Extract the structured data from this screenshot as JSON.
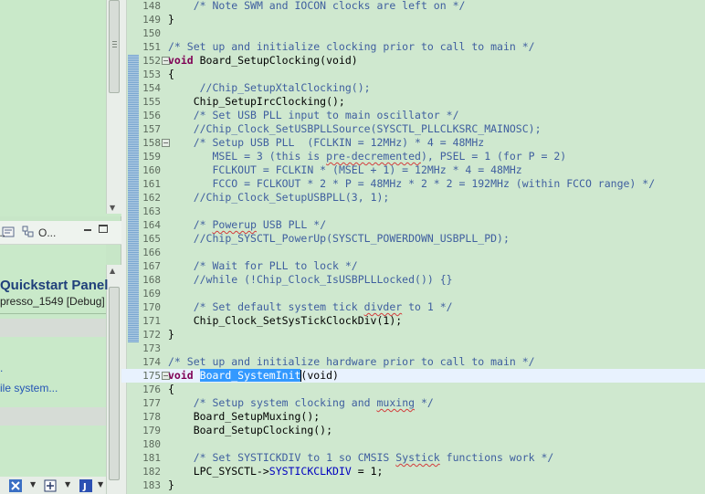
{
  "left_panel": {
    "views": [
      {
        "icon": "views-icon",
        "label": "..."
      },
      {
        "icon": "outline-icon",
        "label": "O..."
      }
    ],
    "quickstart": {
      "title": "Quickstart Panel",
      "subtitle": "presso_1549 [Debug]",
      "link_dot": ".",
      "link_text": "ile system..."
    }
  },
  "editor": {
    "lines": [
      {
        "num": "148",
        "fold": "",
        "text": "    /* Note SWM and IOCON clocks are left on */",
        "kind": "comment"
      },
      {
        "num": "149",
        "fold": "",
        "text": "}",
        "kind": "plain"
      },
      {
        "num": "150",
        "fold": "",
        "text": "",
        "kind": "plain"
      },
      {
        "num": "151",
        "fold": "",
        "text": "/* Set up and initialize clocking prior to call to main */",
        "kind": "comment"
      },
      {
        "num": "152",
        "fold": "minus",
        "text": "void Board_SetupClocking(void)",
        "kind": "decl"
      },
      {
        "num": "153",
        "fold": "",
        "text": "{",
        "kind": "plain"
      },
      {
        "num": "154",
        "fold": "",
        "text": "     //Chip_SetupXtalClocking();",
        "kind": "comment"
      },
      {
        "num": "155",
        "fold": "",
        "text": "    Chip_SetupIrcClocking();",
        "kind": "plain"
      },
      {
        "num": "156",
        "fold": "",
        "text": "    /* Set USB PLL input to main oscillator */",
        "kind": "comment"
      },
      {
        "num": "157",
        "fold": "",
        "text": "    //Chip_Clock_SetUSBPLLSource(SYSCTL_PLLCLKSRC_MAINOSC);",
        "kind": "comment"
      },
      {
        "num": "158",
        "fold": "minus",
        "text": "    /* Setup USB PLL  (FCLKIN = 12MHz) * 4 = 48MHz",
        "kind": "comment"
      },
      {
        "num": "159",
        "fold": "",
        "text": "       MSEL = 3 (this is pre-decremented), PSEL = 1 (for P = 2)",
        "kind": "comment"
      },
      {
        "num": "160",
        "fold": "",
        "text": "       FCLKOUT = FCLKIN * (MSEL + 1) = 12MHz * 4 = 48MHz",
        "kind": "comment"
      },
      {
        "num": "161",
        "fold": "",
        "text": "       FCCO = FCLKOUT * 2 * P = 48MHz * 2 * 2 = 192MHz (within FCCO range) */",
        "kind": "comment"
      },
      {
        "num": "162",
        "fold": "",
        "text": "    //Chip_Clock_SetupUSBPLL(3, 1);",
        "kind": "comment"
      },
      {
        "num": "163",
        "fold": "",
        "text": "",
        "kind": "plain"
      },
      {
        "num": "164",
        "fold": "",
        "text": "    /* Powerup USB PLL */",
        "kind": "comment"
      },
      {
        "num": "165",
        "fold": "",
        "text": "    //Chip_SYSCTL_PowerUp(SYSCTL_POWERDOWN_USBPLL_PD);",
        "kind": "comment"
      },
      {
        "num": "166",
        "fold": "",
        "text": "",
        "kind": "plain"
      },
      {
        "num": "167",
        "fold": "",
        "text": "    /* Wait for PLL to lock */",
        "kind": "comment"
      },
      {
        "num": "168",
        "fold": "",
        "text": "    //while (!Chip_Clock_IsUSBPLLLocked()) {}",
        "kind": "comment"
      },
      {
        "num": "169",
        "fold": "",
        "text": "",
        "kind": "plain"
      },
      {
        "num": "170",
        "fold": "",
        "text": "    /* Set default system tick divder to 1 */",
        "kind": "comment"
      },
      {
        "num": "171",
        "fold": "",
        "text": "    Chip_Clock_SetSysTickClockDiv(1);",
        "kind": "plain"
      },
      {
        "num": "172",
        "fold": "",
        "text": "}",
        "kind": "plain"
      },
      {
        "num": "173",
        "fold": "",
        "text": "",
        "kind": "plain"
      },
      {
        "num": "174",
        "fold": "",
        "text": "/* Set up and initialize hardware prior to call to main */",
        "kind": "comment"
      },
      {
        "num": "175",
        "fold": "minus",
        "text": "void Board_SystemInit(void)",
        "kind": "decl-selected"
      },
      {
        "num": "176",
        "fold": "",
        "text": "{",
        "kind": "plain"
      },
      {
        "num": "177",
        "fold": "",
        "text": "    /* Setup system clocking and muxing */",
        "kind": "comment"
      },
      {
        "num": "178",
        "fold": "",
        "text": "    Board_SetupMuxing();",
        "kind": "plain"
      },
      {
        "num": "179",
        "fold": "",
        "text": "    Board_SetupClocking();",
        "kind": "plain"
      },
      {
        "num": "180",
        "fold": "",
        "text": "",
        "kind": "plain"
      },
      {
        "num": "181",
        "fold": "",
        "text": "    /* Set SYSTICKDIV to 1 so CMSIS Systick functions work */",
        "kind": "comment"
      },
      {
        "num": "182",
        "fold": "",
        "text": "    LPC_SYSCTL->SYSTICKCLKDIV = 1;",
        "kind": "field"
      },
      {
        "num": "183",
        "fold": "",
        "text": "}",
        "kind": "plain"
      }
    ],
    "squiggle_words": [
      "pre-decremented",
      "Powerup",
      "divder",
      "muxing",
      "Systick"
    ],
    "selected_word": "Board_SystemInit",
    "keyword": "void"
  }
}
